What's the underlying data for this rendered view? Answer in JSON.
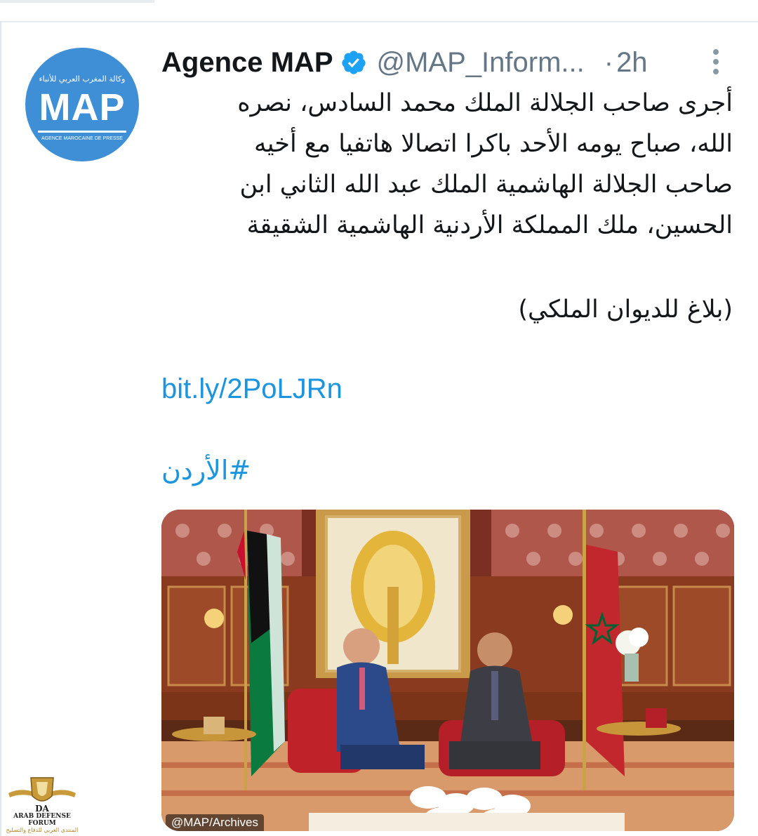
{
  "tweet": {
    "avatar": {
      "logo_text": "MAP",
      "arabic_line": "وكالة المغرب العربي للأنباء",
      "sub_line": "AGENCE MAROCAINE DE PRESSE",
      "background": "#3e8fd6"
    },
    "display_name": "Agence MAP",
    "verified_icon": "verified-badge-icon",
    "handle": "@MAP_Inform...",
    "separator": "·",
    "timestamp": "2h",
    "more_icon": "more-vertical-icon",
    "text_lines": [
      "أجرى صاحب الجلالة الملك محمد السادس، نصره",
      "الله، صباح يومه الأحد باكرا اتصالا هاتفيا مع أخيه",
      "صاحب الجلالة الهاشمية الملك عبد الله الثاني ابن",
      "الحسين، ملك المملكة الأردنية الهاشمية الشقيقة"
    ],
    "note": "(بلاغ للديوان الملكي)",
    "link": "bit.ly/2PoLJRn",
    "hashtag": "#الأردن",
    "media": {
      "credit": "@MAP/Archives"
    },
    "colors": {
      "link": "#1b95e0",
      "secondary_text": "#657786",
      "primary_text": "#14171a"
    }
  },
  "watermark": {
    "title": "ARAB DEFENSE FORUM",
    "subtitle": "المنتدى العربي للدفاع والتسليح",
    "mark": "DA"
  }
}
